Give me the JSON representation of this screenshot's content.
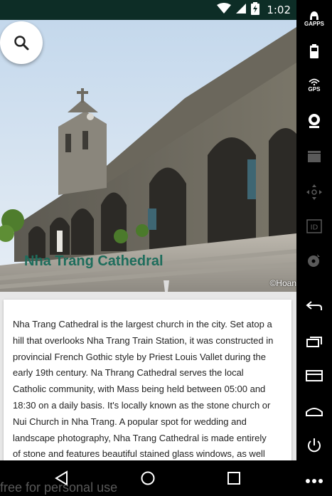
{
  "status_bar": {
    "time": "1:02",
    "icons": [
      "wifi-icon",
      "cell-signal-icon",
      "battery-charging-icon"
    ],
    "background": "#0d2d26"
  },
  "hero": {
    "title": "Nha Trang Cathedral",
    "credit": "©Hoan",
    "title_color": "#1e6d5c"
  },
  "search": {
    "icon": "search-icon"
  },
  "description": {
    "text": "Nha Trang Cathedral is the largest church in the city. Set atop a hill that overlooks Nha Trang Train Station, it was constructed in provincial French Gothic style by Priest Louis Vallet during the early 19th century. Na Thrang Cathedral serves the local Catholic community, with Mass being held between 05:00 and 18:30 on a daily basis. It's locally known as the stone church or Nui Church in Nha Trang. A popular spot for wedding and landscape photography, Nha Trang Cathedral is made entirely of stone and features beautiful stained glass windows, as well as a square"
  },
  "side_toolbar": {
    "gapps_label": "GAPPS",
    "gps_label": "GPS",
    "items": [
      "gapps-icon",
      "battery-icon",
      "gps-icon",
      "camera-icon",
      "video-icon",
      "move-icon",
      "id-icon",
      "disk-icon",
      "back-icon",
      "recents-icon",
      "menu-icon",
      "home-icon",
      "power-icon",
      "more-icon"
    ]
  },
  "nav_bar": {
    "items": [
      "back-icon",
      "home-icon",
      "recents-icon"
    ]
  },
  "watermark": "free for personal use"
}
